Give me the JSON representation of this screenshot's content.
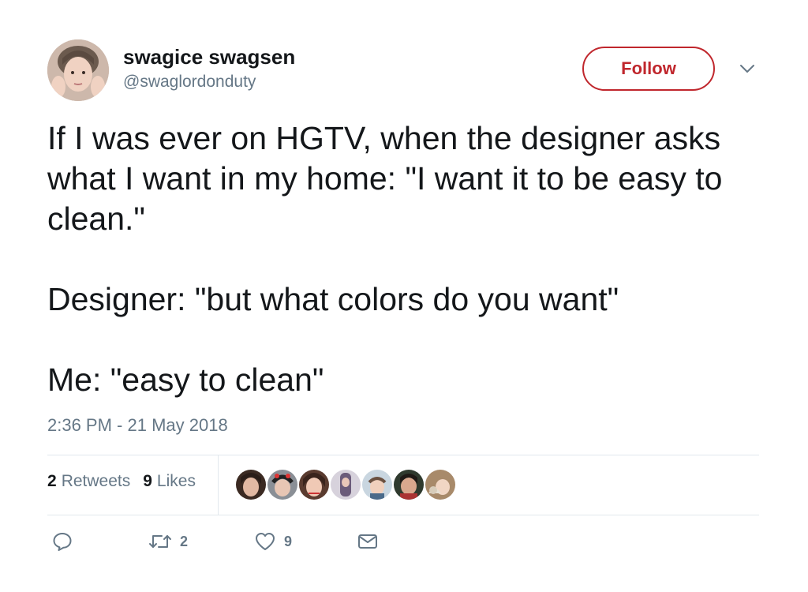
{
  "user": {
    "display_name": "swagice swagsen",
    "handle": "@swaglordonduty"
  },
  "header": {
    "follow_label": "Follow",
    "accent_color": "#c0272d"
  },
  "tweet": {
    "paragraphs": [
      "If I was ever on HGTV, when the designer asks what I want in my home: \"I want it to be easy to clean.\"",
      "Designer: \"but what colors do you want\"",
      "Me: \"easy to clean\""
    ],
    "timestamp": "2:36 PM - 21 May 2018"
  },
  "stats": {
    "retweets_count": "2",
    "retweets_label": "Retweets",
    "likes_count": "9",
    "likes_label": "Likes"
  },
  "actions": {
    "reply_icon": "reply-icon",
    "retweet_icon": "retweet-icon",
    "retweet_count": "2",
    "like_icon": "heart-icon",
    "like_count": "9",
    "message_icon": "envelope-icon"
  }
}
